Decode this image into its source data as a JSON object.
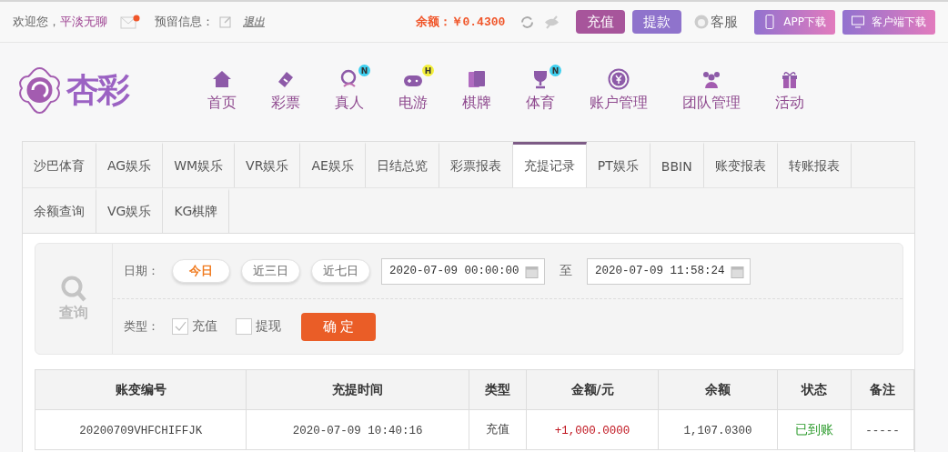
{
  "top_bar": {
    "welcome": "欢迎您，",
    "username": "平淡无聊",
    "has_new_mail": true,
    "reserved_info_label": "预留信息：",
    "logout": "退出",
    "balance_label": "余额：",
    "balance": "￥0.4300",
    "buttons": [
      {
        "label": "充值",
        "kind": "deposit"
      },
      {
        "label": "提款",
        "kind": "withdraw"
      }
    ],
    "service": "客服",
    "downloads": [
      {
        "label": "APP下载",
        "kind": "phone"
      },
      {
        "label": "客户端下载",
        "kind": "desktop"
      }
    ]
  },
  "logo": {
    "text": "杏彩"
  },
  "nav": [
    {
      "label": "首页"
    },
    {
      "label": "彩票"
    },
    {
      "label": "真人",
      "badge": {
        "text": "N",
        "color": "#3fd0f0"
      }
    },
    {
      "label": "电游",
      "badge": {
        "text": "H",
        "color": "#f3ef3a"
      }
    },
    {
      "label": "棋牌"
    },
    {
      "label": "体育",
      "badge": {
        "text": "N",
        "color": "#3fd0f0"
      }
    },
    {
      "label": "账户管理"
    },
    {
      "label": "团队管理"
    },
    {
      "label": "活动"
    }
  ],
  "tab_rows": [
    [
      {
        "label": "沙巴体育",
        "selected": false
      },
      {
        "label": "AG娱乐",
        "selected": false
      },
      {
        "label": "WM娱乐",
        "selected": false
      },
      {
        "label": "VR娱乐",
        "selected": false
      },
      {
        "label": "AE娱乐",
        "selected": false
      },
      {
        "label": "日结总览",
        "selected": false
      },
      {
        "label": "彩票报表",
        "selected": false
      },
      {
        "label": "充提记录",
        "selected": true
      },
      {
        "label": "PT娱乐",
        "selected": false
      },
      {
        "label": "BBIN",
        "selected": false
      },
      {
        "label": "账变报表",
        "selected": false
      },
      {
        "label": "转账报表",
        "selected": false
      }
    ],
    [
      {
        "label": "余额查询",
        "selected": false
      },
      {
        "label": "VG娱乐",
        "selected": false
      },
      {
        "label": "KG棋牌",
        "selected": false
      }
    ]
  ],
  "query": {
    "title": "查询",
    "date_label": "日期：",
    "ranges": [
      {
        "label": "今日",
        "selected": true
      },
      {
        "label": "近三日",
        "selected": false
      },
      {
        "label": "近七日",
        "selected": false
      }
    ],
    "start": "2020-07-09 00:00:00",
    "to": "至",
    "end": "2020-07-09 11:58:24",
    "type_label": "类型：",
    "types": [
      {
        "label": "充值",
        "checked": true
      },
      {
        "label": "提现",
        "checked": false
      }
    ],
    "confirm": "确 定"
  },
  "table": {
    "columns": [
      "账变编号",
      "充提时间",
      "类型",
      "金额/元",
      "余额",
      "状态",
      "备注"
    ],
    "rows": [
      {
        "id": "20200709VHFCHIFFJK",
        "time": "2020-07-09 10:40:16",
        "type": "充值",
        "amount": "+1,000.0000",
        "balance": "1,107.0300",
        "status": "已到账",
        "note": "-----"
      }
    ]
  }
}
